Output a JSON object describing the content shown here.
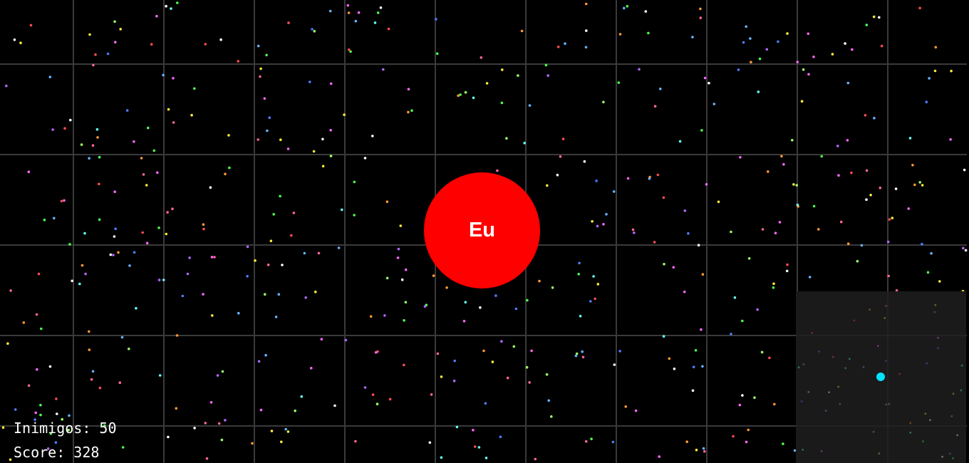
{
  "player": {
    "label": "Eu",
    "color": "#ff0000"
  },
  "hud": {
    "enemies_label": "Inimigos:",
    "enemies_count": "50",
    "score_label": "Score:",
    "score_value": "328"
  },
  "colors": {
    "background": "#000000",
    "grid": "#3a3a3a",
    "minimap_bg": "#1a1a1a",
    "minimap_player": "#00e5ff"
  }
}
